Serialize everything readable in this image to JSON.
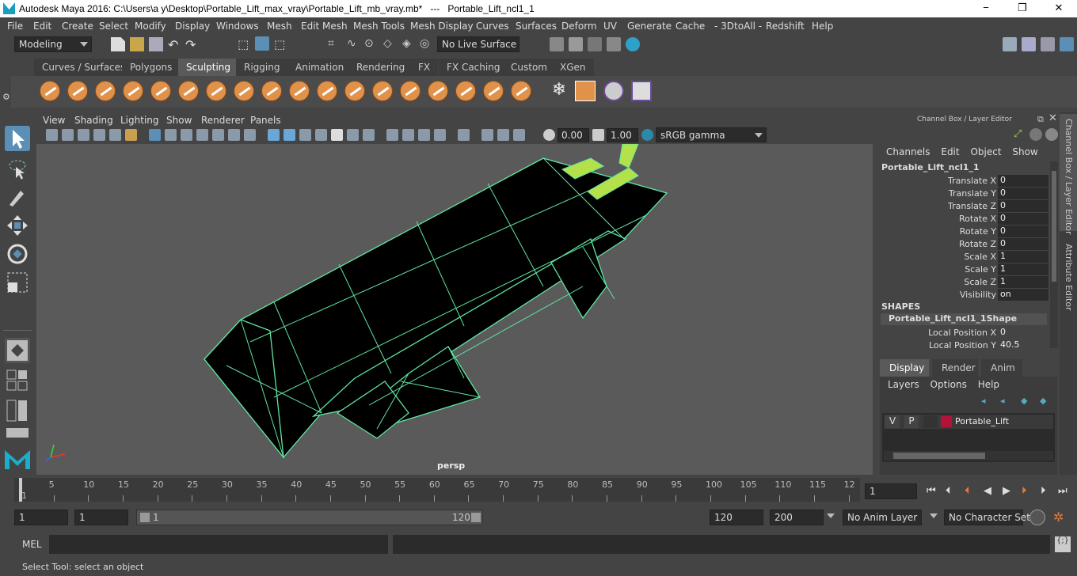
{
  "window": {
    "title": "Autodesk Maya 2016: C:\\Users\\a y\\Desktop\\Portable_Lift_max_vray\\Portable_Lift_mb_vray.mb*   ---   Portable_Lift_ncl1_1",
    "min": "−",
    "max": "❐",
    "close": "✕"
  },
  "menu": [
    "File",
    "Edit",
    "Create",
    "Select",
    "Modify",
    "Display",
    "Windows",
    "Mesh",
    "Edit Mesh",
    "Mesh Tools",
    "Mesh Display",
    "Curves",
    "Surfaces",
    "Deform",
    "UV",
    "Generate",
    "Cache",
    "- 3DtoAll -",
    "Redshift",
    "Help"
  ],
  "status": {
    "mode": "Modeling",
    "live_surface": "No Live Surface"
  },
  "shelf_tabs": [
    "Curves / Surfaces",
    "Polygons",
    "Sculpting",
    "Rigging",
    "Animation",
    "Rendering",
    "FX",
    "FX Caching",
    "Custom",
    "XGen"
  ],
  "shelf_active": "Sculpting",
  "viewport": {
    "menu": [
      "View",
      "Shading",
      "Lighting",
      "Show",
      "Renderer",
      "Panels"
    ],
    "near": "0.00",
    "far": "1.00",
    "colorspace": "sRGB gamma",
    "camera": "persp"
  },
  "channel_box": {
    "header": "Channel Box / Layer Editor",
    "menu": [
      "Channels",
      "Edit",
      "Object",
      "Show"
    ],
    "object": "Portable_Lift_ncl1_1",
    "attributes": [
      {
        "label": "Translate X",
        "value": "0"
      },
      {
        "label": "Translate Y",
        "value": "0"
      },
      {
        "label": "Translate Z",
        "value": "0"
      },
      {
        "label": "Rotate X",
        "value": "0"
      },
      {
        "label": "Rotate Y",
        "value": "0"
      },
      {
        "label": "Rotate Z",
        "value": "0"
      },
      {
        "label": "Scale X",
        "value": "1"
      },
      {
        "label": "Scale Y",
        "value": "1"
      },
      {
        "label": "Scale Z",
        "value": "1"
      },
      {
        "label": "Visibility",
        "value": "on"
      }
    ],
    "shapes_title": "SHAPES",
    "shape_name": "Portable_Lift_ncl1_1Shape",
    "shape_attributes": [
      {
        "label": "Local Position X",
        "value": "0"
      },
      {
        "label": "Local Position Y",
        "value": "40.5"
      }
    ]
  },
  "layer_editor": {
    "tabs": [
      "Display",
      "Render",
      "Anim"
    ],
    "menu": [
      "Layers",
      "Options",
      "Help"
    ],
    "layer": {
      "v": "V",
      "p": "P",
      "name": "Portable_Lift",
      "color": "#b5123a"
    }
  },
  "side_tabs": [
    "Channel Box / Layer Editor",
    "Attribute Editor"
  ],
  "timeline": {
    "ticks": [
      "1",
      "5",
      "10",
      "15",
      "20",
      "25",
      "30",
      "35",
      "40",
      "45",
      "50",
      "55",
      "60",
      "65",
      "70",
      "75",
      "80",
      "85",
      "90",
      "95",
      "100",
      "105",
      "110",
      "115",
      "12"
    ],
    "current": "1"
  },
  "range": {
    "start": "1",
    "anim_start": "1",
    "slider_start": "1",
    "slider_end": "120",
    "end": "120",
    "anim_end": "200",
    "anim_layer": "No Anim Layer",
    "char_set": "No Character Set"
  },
  "command": {
    "label": "MEL"
  },
  "help": "Select Tool: select an object"
}
